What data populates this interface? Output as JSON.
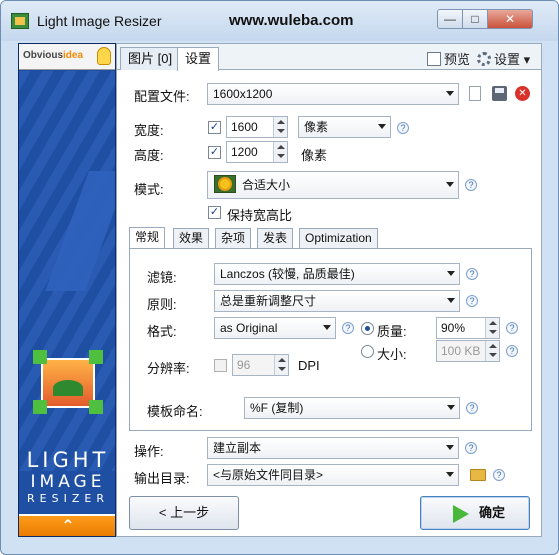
{
  "window": {
    "title": "Light Image Resizer",
    "site_url": "www.wuleba.com",
    "controls": {
      "minimize": "—",
      "maximize": "□",
      "close": "✕"
    }
  },
  "sidebar": {
    "brand_prefix": "Obvious",
    "brand_suffix": "idea",
    "logo_line1": "LIGHT",
    "logo_line2": "IMAGE",
    "logo_line3": "RESIZER",
    "collapse_glyph": "⌃"
  },
  "tabs": {
    "images": "图片 [0]",
    "settings": "设置"
  },
  "toolbar": {
    "preview": "预览",
    "settings": "设置",
    "settings_arrow": "▾"
  },
  "form": {
    "profile_label": "配置文件:",
    "profile_value": "1600x1200",
    "width_label": "宽度:",
    "width_value": "1600",
    "unit_value": "像素",
    "height_label": "高度:",
    "height_value": "1200",
    "height_unit": "像素",
    "mode_label": "模式:",
    "mode_value": "合适大小",
    "keep_ratio_label": "保持宽高比",
    "operation_label": "操作:",
    "operation_value": "建立副本",
    "output_label": "输出目录:",
    "output_value": "<与原始文件同目录>"
  },
  "subtabs": {
    "general": "常规",
    "effects": "效果",
    "misc": "杂项",
    "publish": "发表",
    "optimization": "Optimization"
  },
  "general": {
    "filter_label": "滤镜:",
    "filter_value": "Lanczos (较慢, 品质最佳)",
    "rule_label": "原则:",
    "rule_value": "总是重新调整尺寸",
    "format_label": "格式:",
    "format_value": "as Original",
    "quality_label": "质量:",
    "quality_value": "90%",
    "size_label": "大小:",
    "size_value": "100 KB",
    "dpi_label": "分辨率:",
    "dpi_value": "96",
    "dpi_unit": "DPI",
    "template_label": "模板命名:",
    "template_value": "%F (复制)"
  },
  "buttons": {
    "back": "< 上一步",
    "ok": "确定"
  },
  "glyphs": {
    "check": "✓",
    "help": "?",
    "close_x": "✕"
  },
  "colors": {
    "sidebar_blue": "#1f4fa3",
    "accent_orange": "#f08a00",
    "ok_green": "#48b83a"
  },
  "icons": [
    "app-icon",
    "lightbulb-icon",
    "preview-icon",
    "gear-icon",
    "new-profile-icon",
    "save-icon",
    "delete-icon",
    "sunflower-icon",
    "help-icon",
    "folder-icon",
    "play-arrow-icon"
  ]
}
